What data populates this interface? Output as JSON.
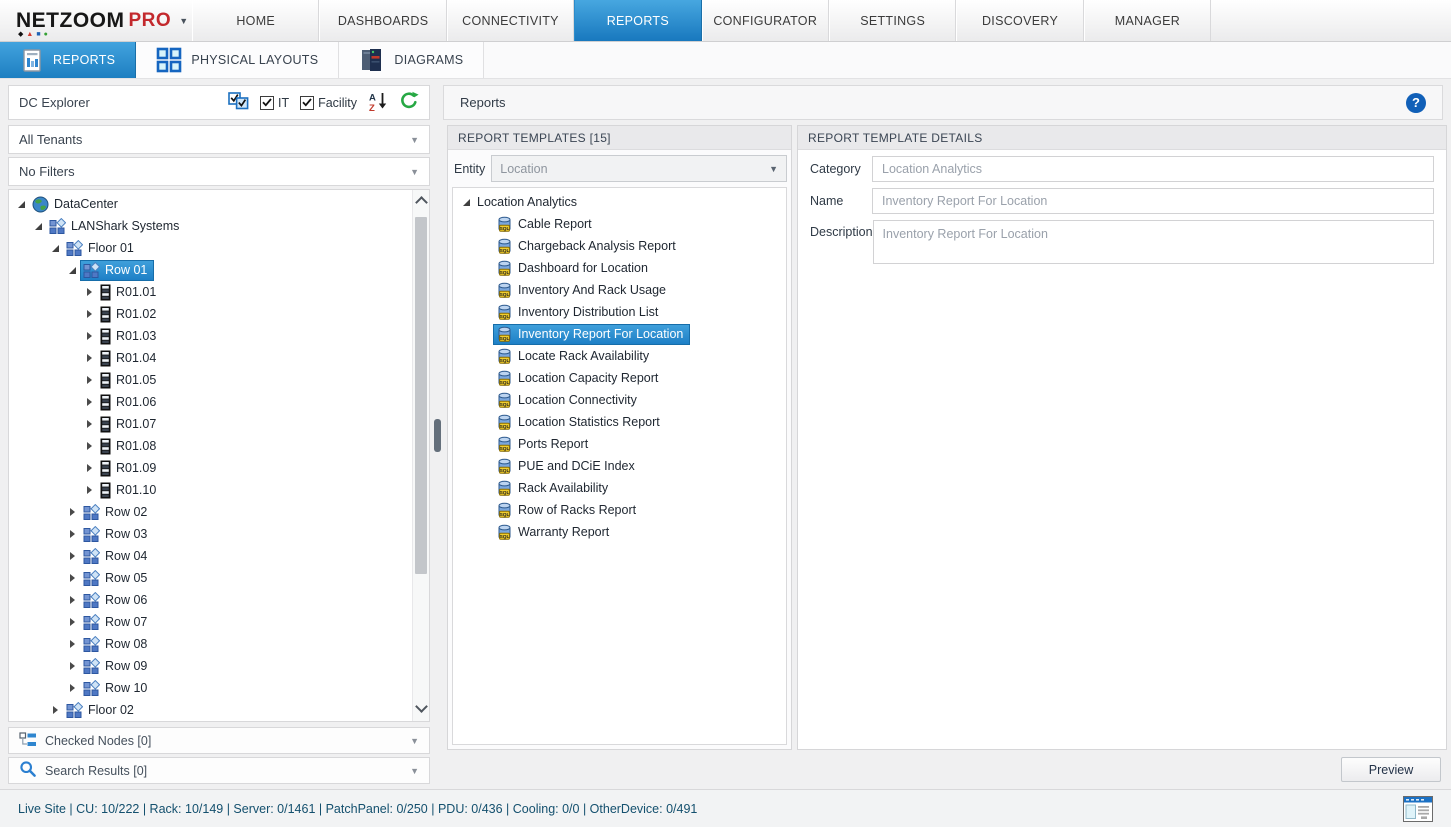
{
  "colors": {
    "accent_blue": "#2b8dd6",
    "active_tab_top": "#47a7e0",
    "active_tab_bottom": "#1878be",
    "logo_red": "#c3292d",
    "refresh_green": "#27a844",
    "status_text": "#14506e"
  },
  "logo": {
    "brand": "NETZOOM",
    "edition": "PRO"
  },
  "top_nav": [
    {
      "label": "HOME",
      "active": false
    },
    {
      "label": "DASHBOARDS",
      "active": false
    },
    {
      "label": "CONNECTIVITY",
      "active": false
    },
    {
      "label": "REPORTS",
      "active": true
    },
    {
      "label": "CONFIGURATOR",
      "active": false
    },
    {
      "label": "SETTINGS",
      "active": false
    },
    {
      "label": "DISCOVERY",
      "active": false
    },
    {
      "label": "MANAGER",
      "active": false
    }
  ],
  "sub_nav": [
    {
      "label": "REPORTS",
      "icon": "report-document-icon",
      "active": true
    },
    {
      "label": "PHYSICAL LAYOUTS",
      "icon": "layout-grid-icon",
      "active": false
    },
    {
      "label": "DIAGRAMS",
      "icon": "server-rack-icon",
      "active": false
    }
  ],
  "dc_explorer": {
    "title": "DC Explorer",
    "toolbar": {
      "multi_select_icon": "multi-checkbox-icon",
      "checkboxes": [
        {
          "label": "IT",
          "checked": true
        },
        {
          "label": "Facility",
          "checked": true
        }
      ],
      "sort_icon": "sort-az-icon",
      "refresh_icon": "refresh-icon"
    },
    "tenants_dropdown": {
      "value": "All Tenants"
    },
    "filters_dropdown": {
      "value": "No Filters"
    },
    "tree": [
      {
        "label": "DataCenter",
        "depth": 0,
        "icon": "globe",
        "state": "expanded",
        "selected": false
      },
      {
        "label": "LANShark Systems",
        "depth": 1,
        "icon": "site",
        "state": "expanded",
        "selected": false
      },
      {
        "label": "Floor 01",
        "depth": 2,
        "icon": "site",
        "state": "expanded",
        "selected": false
      },
      {
        "label": "Row 01",
        "depth": 3,
        "icon": "site",
        "state": "expanded",
        "selected": true
      },
      {
        "label": "R01.01",
        "depth": 4,
        "icon": "rack",
        "state": "collapsed",
        "selected": false
      },
      {
        "label": "R01.02",
        "depth": 4,
        "icon": "rack",
        "state": "collapsed",
        "selected": false
      },
      {
        "label": "R01.03",
        "depth": 4,
        "icon": "rack",
        "state": "collapsed",
        "selected": false
      },
      {
        "label": "R01.04",
        "depth": 4,
        "icon": "rack",
        "state": "collapsed",
        "selected": false
      },
      {
        "label": "R01.05",
        "depth": 4,
        "icon": "rack",
        "state": "collapsed",
        "selected": false
      },
      {
        "label": "R01.06",
        "depth": 4,
        "icon": "rack",
        "state": "collapsed",
        "selected": false
      },
      {
        "label": "R01.07",
        "depth": 4,
        "icon": "rack",
        "state": "collapsed",
        "selected": false
      },
      {
        "label": "R01.08",
        "depth": 4,
        "icon": "rack",
        "state": "collapsed",
        "selected": false
      },
      {
        "label": "R01.09",
        "depth": 4,
        "icon": "rack",
        "state": "collapsed",
        "selected": false
      },
      {
        "label": "R01.10",
        "depth": 4,
        "icon": "rack",
        "state": "collapsed",
        "selected": false
      },
      {
        "label": "Row 02",
        "depth": 3,
        "icon": "site",
        "state": "collapsed",
        "selected": false
      },
      {
        "label": "Row 03",
        "depth": 3,
        "icon": "site",
        "state": "collapsed",
        "selected": false
      },
      {
        "label": "Row 04",
        "depth": 3,
        "icon": "site",
        "state": "collapsed",
        "selected": false
      },
      {
        "label": "Row 05",
        "depth": 3,
        "icon": "site",
        "state": "collapsed",
        "selected": false
      },
      {
        "label": "Row 06",
        "depth": 3,
        "icon": "site",
        "state": "collapsed",
        "selected": false
      },
      {
        "label": "Row 07",
        "depth": 3,
        "icon": "site",
        "state": "collapsed",
        "selected": false
      },
      {
        "label": "Row 08",
        "depth": 3,
        "icon": "site",
        "state": "collapsed",
        "selected": false
      },
      {
        "label": "Row 09",
        "depth": 3,
        "icon": "site",
        "state": "collapsed",
        "selected": false
      },
      {
        "label": "Row 10",
        "depth": 3,
        "icon": "site",
        "state": "collapsed",
        "selected": false
      },
      {
        "label": "Floor 02",
        "depth": 2,
        "icon": "site",
        "state": "collapsed",
        "selected": false
      }
    ],
    "checked_nodes": {
      "label": "Checked Nodes [0]",
      "icon": "tree-nodes-icon"
    },
    "search_results": {
      "label": "Search Results [0]",
      "icon": "search-icon"
    }
  },
  "reports_view": {
    "title": "Reports",
    "help_icon": "help-icon",
    "templates_panel": {
      "header": "REPORT TEMPLATES [15]",
      "entity": {
        "label": "Entity",
        "value": "Location"
      },
      "tree": [
        {
          "label": "Location Analytics",
          "type": "category",
          "state": "expanded",
          "selected": false
        },
        {
          "label": "Cable Report",
          "type": "report",
          "selected": false
        },
        {
          "label": "Chargeback Analysis Report",
          "type": "report",
          "selected": false
        },
        {
          "label": "Dashboard for Location",
          "type": "report",
          "selected": false
        },
        {
          "label": "Inventory And Rack Usage",
          "type": "report",
          "selected": false
        },
        {
          "label": "Inventory Distribution List",
          "type": "report",
          "selected": false
        },
        {
          "label": "Inventory Report For Location",
          "type": "report",
          "selected": true
        },
        {
          "label": "Locate Rack Availability",
          "type": "report",
          "selected": false
        },
        {
          "label": "Location Capacity Report",
          "type": "report",
          "selected": false
        },
        {
          "label": "Location Connectivity",
          "type": "report",
          "selected": false
        },
        {
          "label": "Location Statistics Report",
          "type": "report",
          "selected": false
        },
        {
          "label": "Ports Report",
          "type": "report",
          "selected": false
        },
        {
          "label": "PUE and DCiE Index",
          "type": "report",
          "selected": false
        },
        {
          "label": "Rack Availability",
          "type": "report",
          "selected": false
        },
        {
          "label": "Row of Racks Report",
          "type": "report",
          "selected": false
        },
        {
          "label": "Warranty Report",
          "type": "report",
          "selected": false
        }
      ]
    },
    "details_panel": {
      "header": "REPORT TEMPLATE DETAILS",
      "fields": [
        {
          "label": "Category",
          "value": "Location Analytics",
          "type": "input"
        },
        {
          "label": "Name",
          "value": "Inventory Report For Location",
          "type": "input"
        },
        {
          "label": "Description",
          "value": "Inventory Report For Location",
          "type": "textarea"
        }
      ]
    },
    "preview_button": "Preview"
  },
  "status_bar": {
    "text": "Live Site | CU: 10/222 | Rack: 10/149 | Server: 0/1461 | PatchPanel: 0/250 | PDU: 0/436 | Cooling: 0/0 | OtherDevice: 0/491",
    "window_icon": "mini-window-icon"
  }
}
